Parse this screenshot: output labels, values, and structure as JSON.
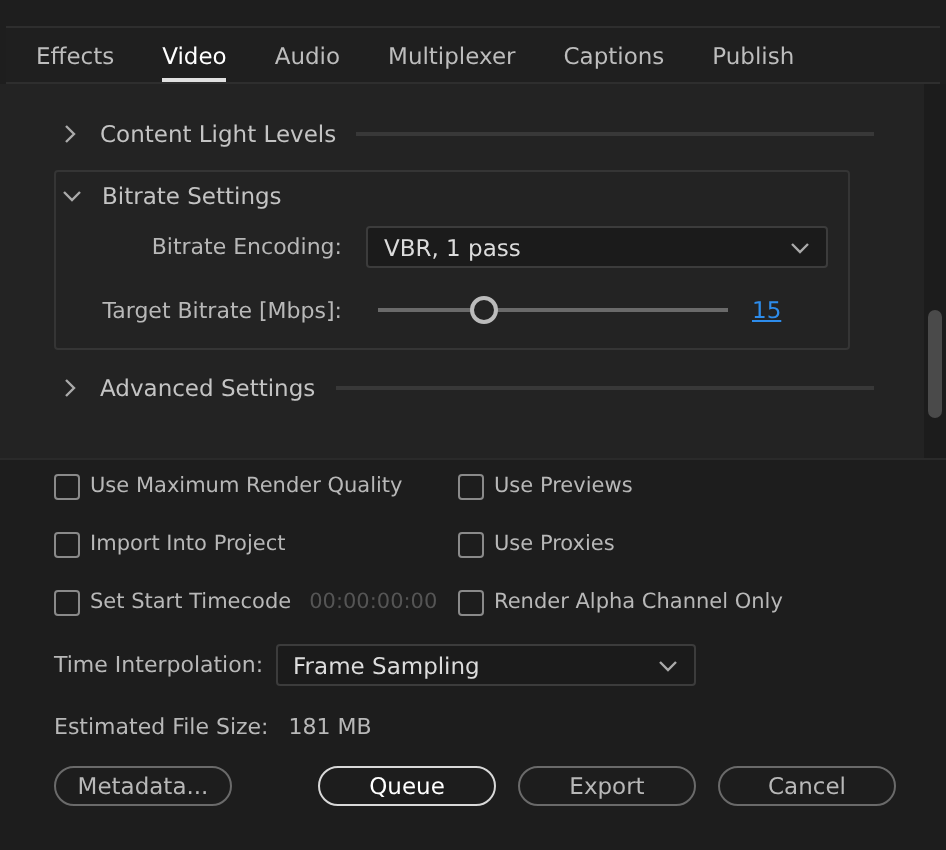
{
  "tabs": [
    {
      "label": "Effects",
      "selected": false
    },
    {
      "label": "Video",
      "selected": true
    },
    {
      "label": "Audio",
      "selected": false
    },
    {
      "label": "Multiplexer",
      "selected": false
    },
    {
      "label": "Captions",
      "selected": false
    },
    {
      "label": "Publish",
      "selected": false
    }
  ],
  "sections": [
    {
      "title": "Content Light Levels",
      "expanded": false
    },
    {
      "title": "Bitrate Settings",
      "expanded": true,
      "fields": [
        {
          "kind": "select",
          "label": "Bitrate Encoding:",
          "value": "VBR, 1 pass"
        },
        {
          "kind": "slider",
          "label": "Target Bitrate [Mbps]:",
          "level": 0.3,
          "reading": "15"
        }
      ]
    },
    {
      "title": "Advanced Settings",
      "expanded": false
    }
  ],
  "options": [
    {
      "label": "Use Maximum Render Quality",
      "checked": false
    },
    {
      "label": "Use Previews",
      "checked": false
    },
    {
      "label": "Import Into Project",
      "checked": false
    },
    {
      "label": "Use Proxies",
      "checked": false
    },
    {
      "label": "Set Start Timecode",
      "checked": false,
      "timecode": "00:00:00:00"
    },
    {
      "label": "Render Alpha Channel Only",
      "checked": false
    }
  ],
  "time_interpolation": {
    "label": "Time Interpolation:",
    "value": "Frame Sampling"
  },
  "file_size": {
    "label": "Estimated File Size:",
    "value": "181 MB"
  },
  "buttons": [
    {
      "label": "Metadata...",
      "default": false
    },
    {
      "label": "Queue",
      "default": true
    },
    {
      "label": "Export",
      "default": false
    },
    {
      "label": "Cancel",
      "default": false
    }
  ]
}
